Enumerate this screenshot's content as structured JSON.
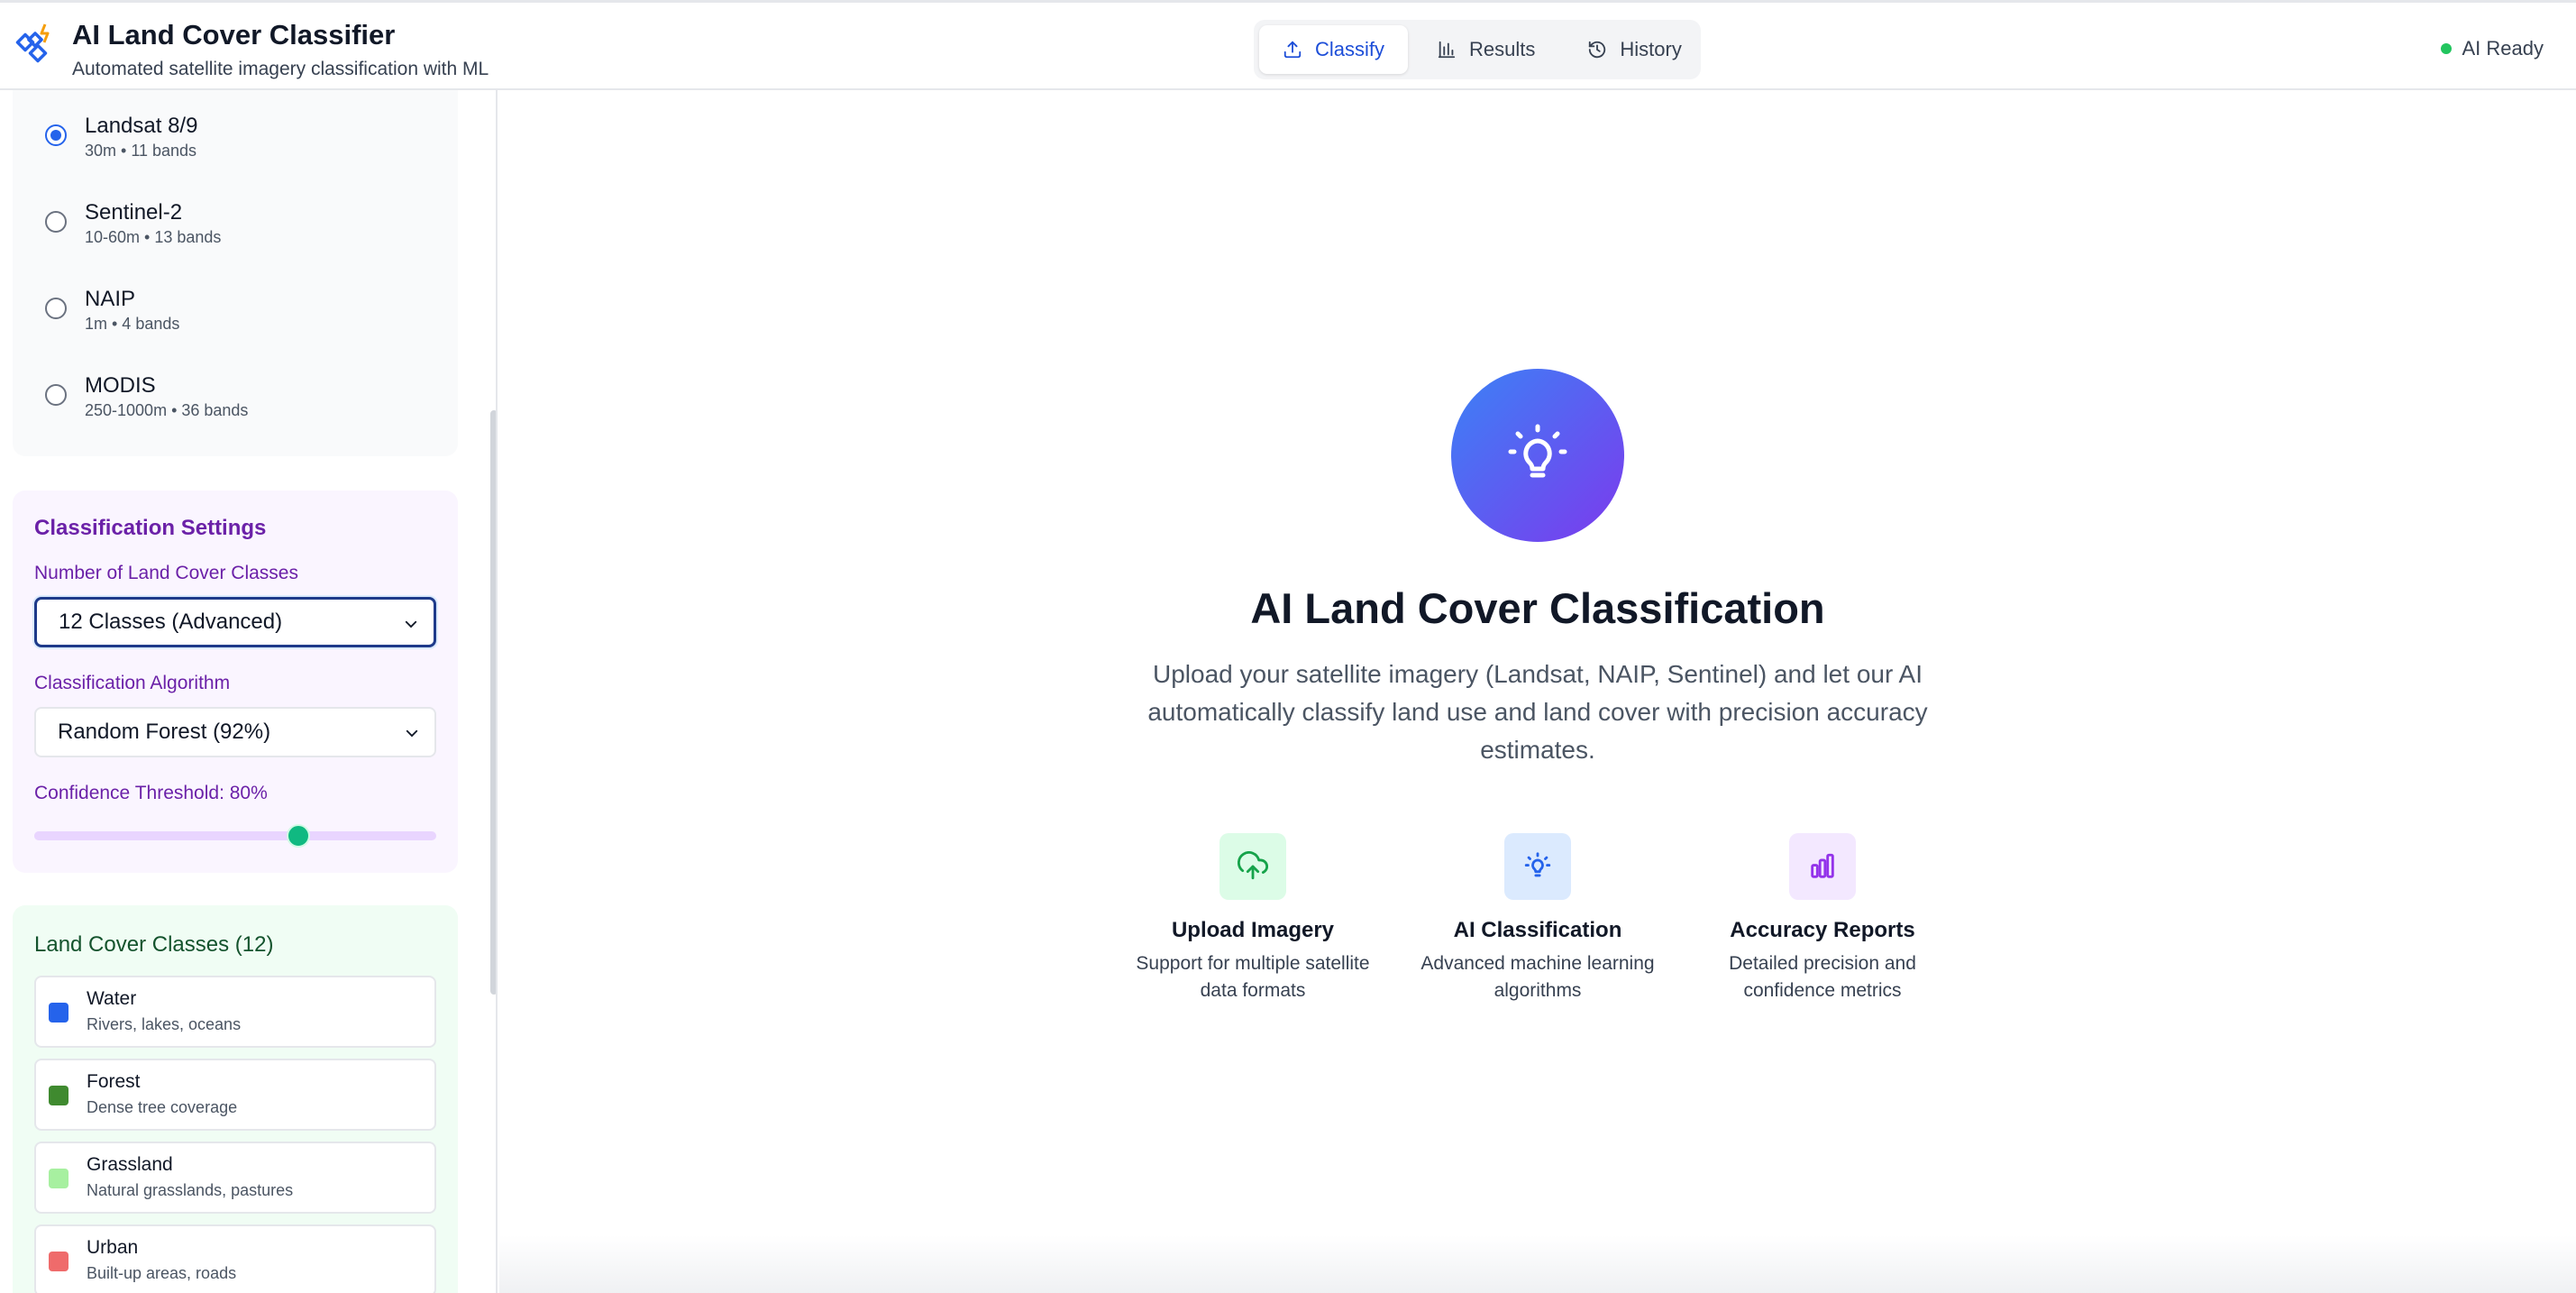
{
  "header": {
    "title": "AI Land Cover Classifier",
    "subtitle": "Automated satellite imagery classification with ML",
    "tabs": [
      {
        "label": "Classify",
        "icon": "upload-icon",
        "active": true
      },
      {
        "label": "Results",
        "icon": "bar-chart-icon",
        "active": false
      },
      {
        "label": "History",
        "icon": "history-icon",
        "active": false
      }
    ],
    "status": "AI Ready"
  },
  "sidebar": {
    "satellites": [
      {
        "name": "Landsat 8/9",
        "detail": "30m • 11 bands",
        "selected": true
      },
      {
        "name": "Sentinel-2",
        "detail": "10-60m • 13 bands",
        "selected": false
      },
      {
        "name": "NAIP",
        "detail": "1m • 4 bands",
        "selected": false
      },
      {
        "name": "MODIS",
        "detail": "250-1000m • 36 bands",
        "selected": false
      }
    ],
    "settings": {
      "title": "Classification Settings",
      "classes_label": "Number of Land Cover Classes",
      "classes_value": "12 Classes (Advanced)",
      "algorithm_label": "Classification Algorithm",
      "algorithm_value": "Random Forest (92%)",
      "threshold_label": "Confidence Threshold: 80%",
      "threshold_value": 0.8
    },
    "land_cover": {
      "title": "Land Cover Classes (12)",
      "items": [
        {
          "name": "Water",
          "desc": "Rivers, lakes, oceans",
          "color": "#2563eb"
        },
        {
          "name": "Forest",
          "desc": "Dense tree coverage",
          "color": "#3f8a2f"
        },
        {
          "name": "Grassland",
          "desc": "Natural grasslands, pastures",
          "color": "#a7f0a0"
        },
        {
          "name": "Urban",
          "desc": "Built-up areas, roads",
          "color": "#ef6b6b"
        }
      ]
    }
  },
  "main": {
    "hero_icon": "lightbulb-icon",
    "title": "AI Land Cover Classification",
    "description": "Upload your satellite imagery (Landsat, NAIP, Sentinel) and let our AI automatically classify land use and land cover with precision accuracy estimates.",
    "features": [
      {
        "title": "Upload Imagery",
        "desc": "Support for multiple satellite data formats",
        "icon": "cloud-upload-icon"
      },
      {
        "title": "AI Classification",
        "desc": "Advanced machine learning algorithms",
        "icon": "lightbulb-icon"
      },
      {
        "title": "Accuracy Reports",
        "desc": "Detailed precision and confidence metrics",
        "icon": "bar-chart-icon"
      }
    ]
  },
  "colors": {
    "accent": "#2563eb",
    "purple": "#7c3aed",
    "status": "#22c55e"
  }
}
